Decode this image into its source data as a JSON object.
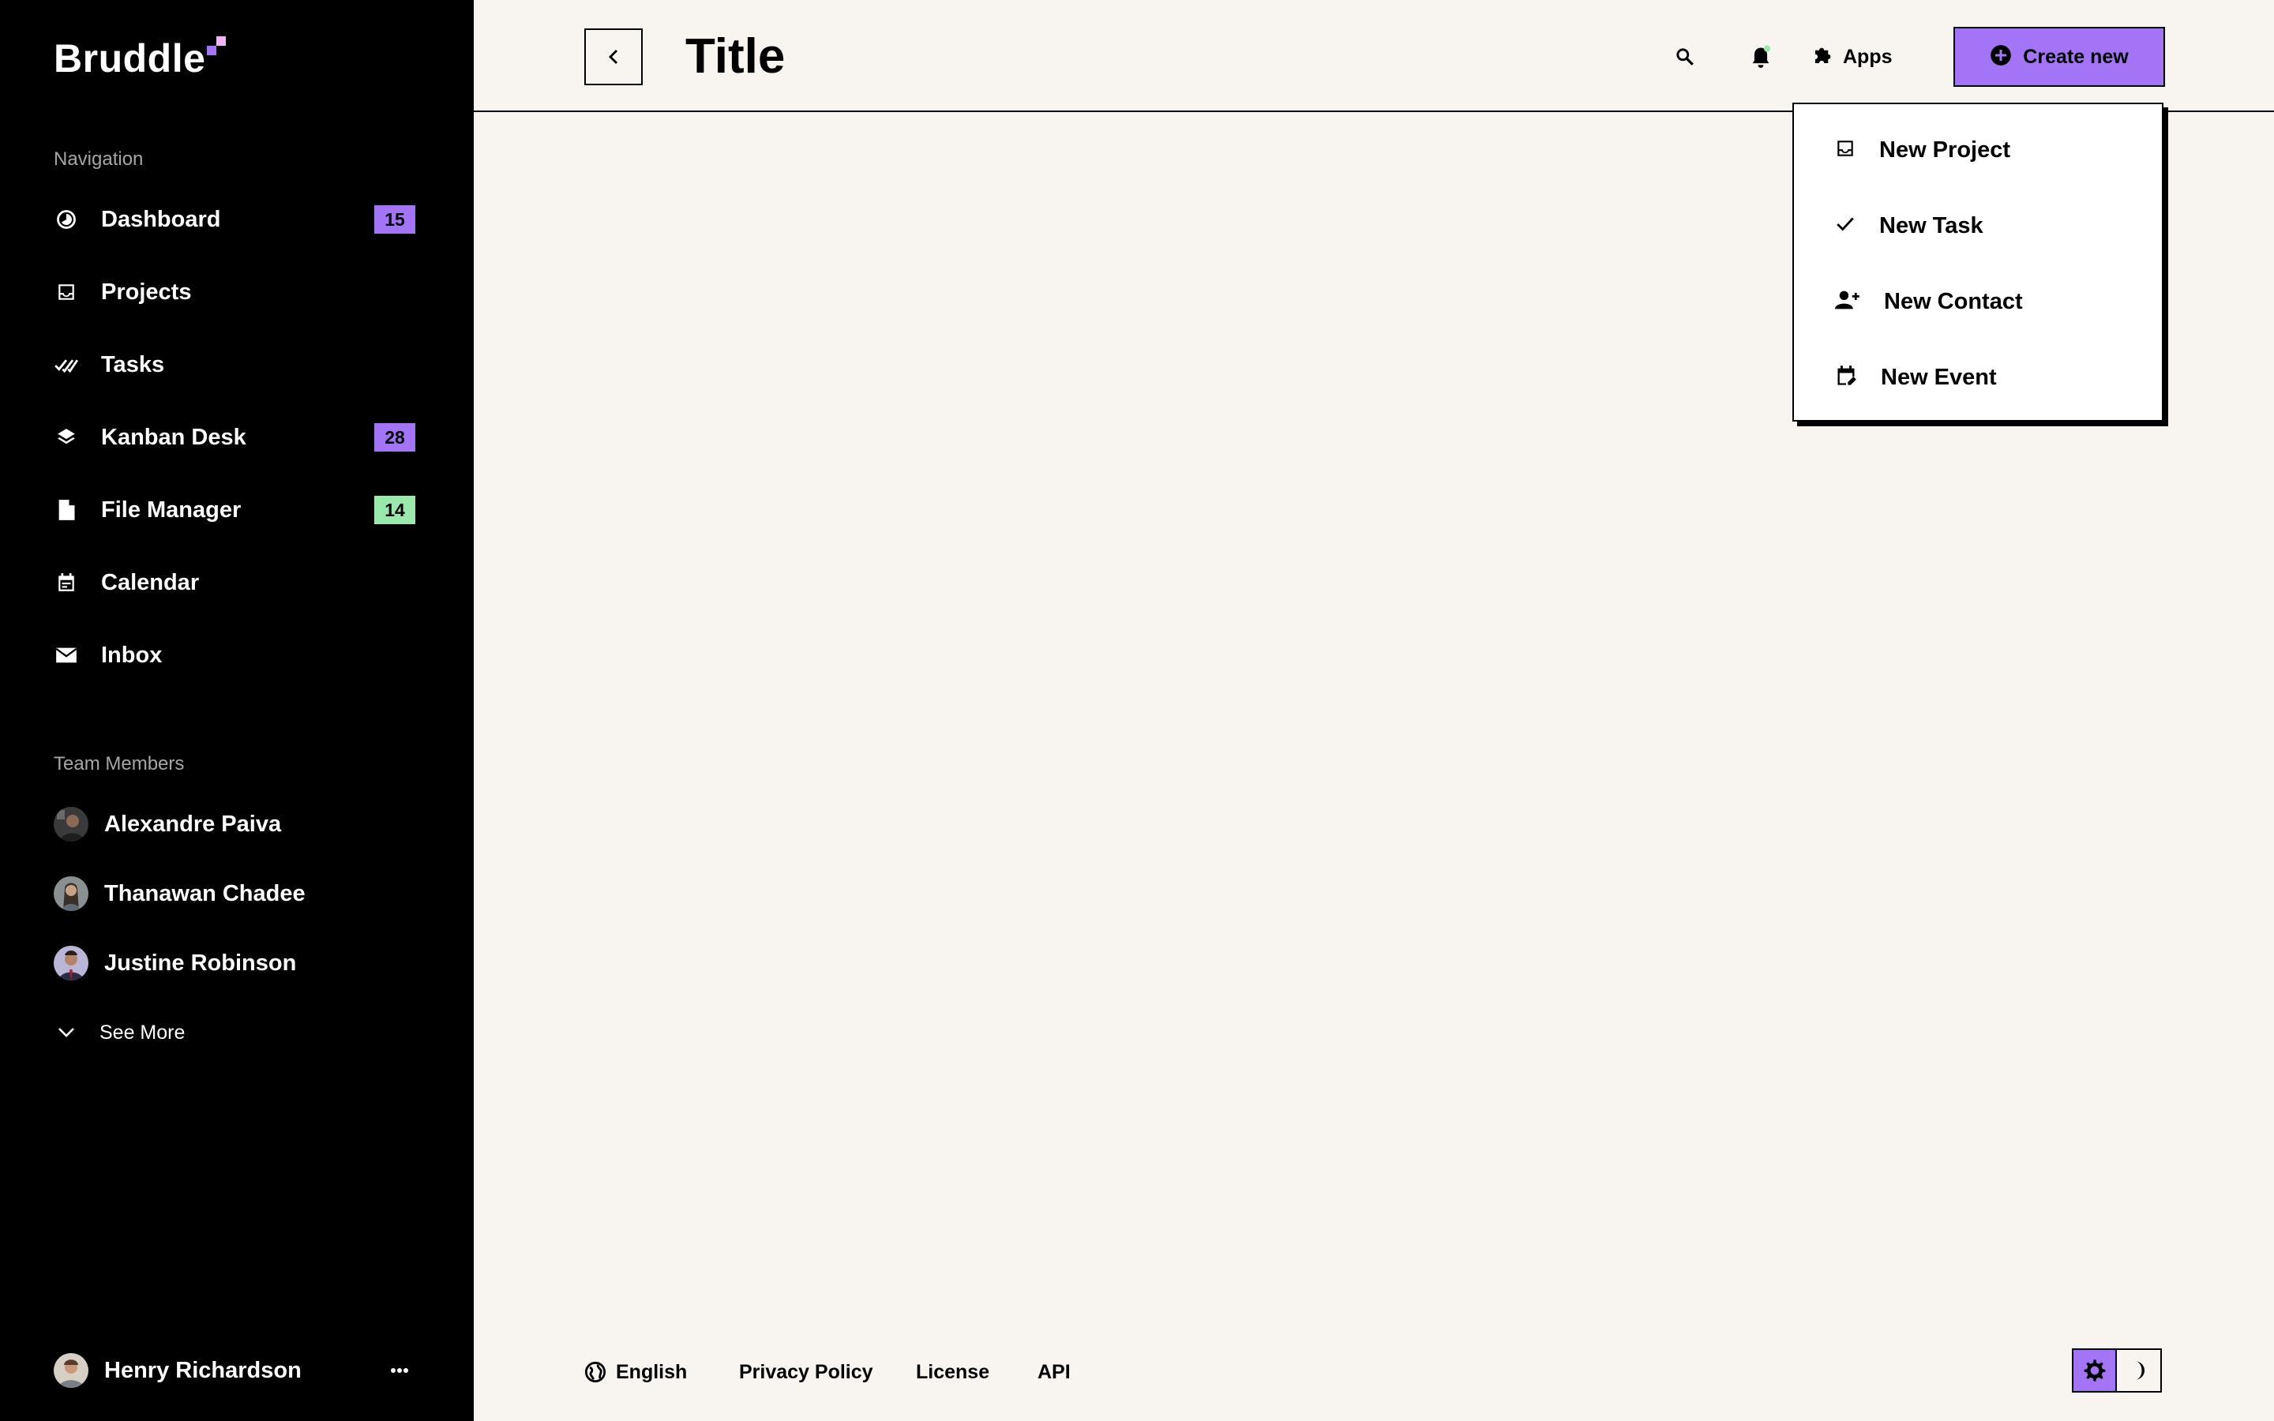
{
  "app": {
    "logo": "Bruddle"
  },
  "sidebar": {
    "nav_title": "Navigation",
    "nav": [
      {
        "label": "Dashboard",
        "icon": "dashboard-icon",
        "badge": "15",
        "badge_color": "#a374f5"
      },
      {
        "label": "Projects",
        "icon": "inbox-tray-icon"
      },
      {
        "label": "Tasks",
        "icon": "double-check-icon"
      },
      {
        "label": "Kanban Desk",
        "icon": "layers-icon",
        "badge": "28",
        "badge_color": "#a374f5"
      },
      {
        "label": "File Manager",
        "icon": "file-icon",
        "badge": "14",
        "badge_color": "#98e9ab"
      },
      {
        "label": "Calendar",
        "icon": "calendar-icon"
      },
      {
        "label": "Inbox",
        "icon": "mail-icon"
      }
    ],
    "team_title": "Team Members",
    "team": [
      {
        "name": "Alexandre Paiva"
      },
      {
        "name": "Thanawan Chadee"
      },
      {
        "name": "Justine Robinson"
      }
    ],
    "see_more": "See More",
    "profile": {
      "name": "Henry Richardson"
    }
  },
  "header": {
    "title": "Title",
    "apps_label": "Apps",
    "create_label": "Create new",
    "accent_color": "#a374f5"
  },
  "dropdown": {
    "items": [
      {
        "label": "New Project",
        "icon": "inbox-tray-icon"
      },
      {
        "label": "New Task",
        "icon": "check-icon"
      },
      {
        "label": "New Contact",
        "icon": "add-contact-icon"
      },
      {
        "label": "New Event",
        "icon": "calendar-edit-icon"
      }
    ]
  },
  "footer": {
    "language": "English",
    "links": [
      "Privacy Policy",
      "License",
      "API"
    ]
  }
}
